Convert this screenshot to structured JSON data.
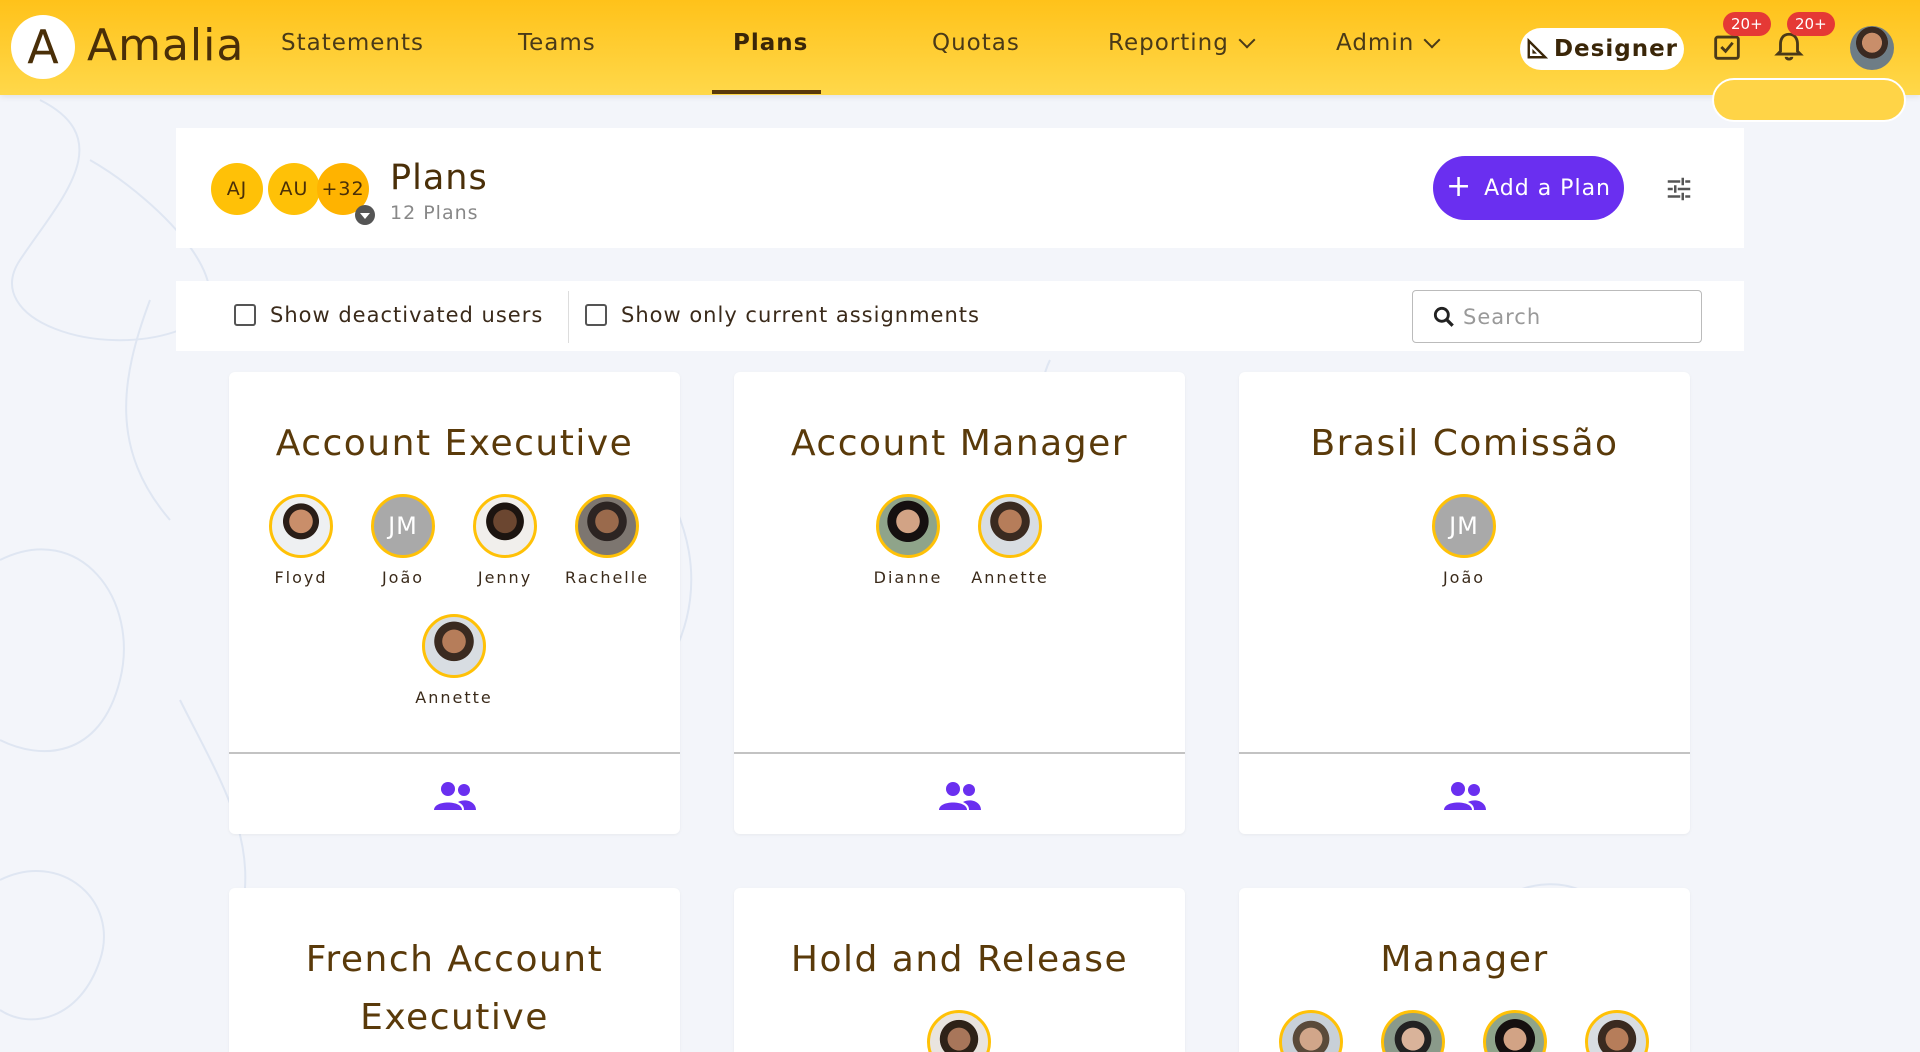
{
  "app": {
    "name": "Amalia",
    "logo_letter": "A"
  },
  "nav": {
    "items": [
      {
        "label": "Statements"
      },
      {
        "label": "Teams"
      },
      {
        "label": "Plans",
        "active": true
      },
      {
        "label": "Quotas"
      },
      {
        "label": "Reporting",
        "has_dropdown": true
      },
      {
        "label": "Admin",
        "has_dropdown": true
      }
    ],
    "designer_label": "Designer",
    "todo_badge": "20+",
    "notifications_badge": "20+"
  },
  "header": {
    "avatars": [
      "AJ",
      "AU",
      "+32"
    ],
    "title": "Plans",
    "subtitle": "12 Plans",
    "add_button_label": "Add a Plan"
  },
  "filters": {
    "show_deactivated_label": "Show deactivated users",
    "show_current_label": "Show only current assignments",
    "search_placeholder": "Search"
  },
  "cards": [
    {
      "title": "Account Executive",
      "members": [
        "Floyd",
        "João",
        "Jenny",
        "Rachelle",
        "Annette"
      ]
    },
    {
      "title": "Account Manager",
      "members": [
        "Dianne",
        "Annette"
      ]
    },
    {
      "title": "Brasil Comissão",
      "members": [
        "João"
      ]
    },
    {
      "title_lines": [
        "French Account",
        "Executive"
      ]
    },
    {
      "title": "Hold and Release"
    },
    {
      "title": "Manager"
    }
  ],
  "member_initials": {
    "João": "JM"
  },
  "colors": {
    "brand_yellow": "#ffc21a",
    "primary_purple": "#6a2ff0",
    "title_brown": "#5a3a0a",
    "badge_red": "#e53935"
  }
}
